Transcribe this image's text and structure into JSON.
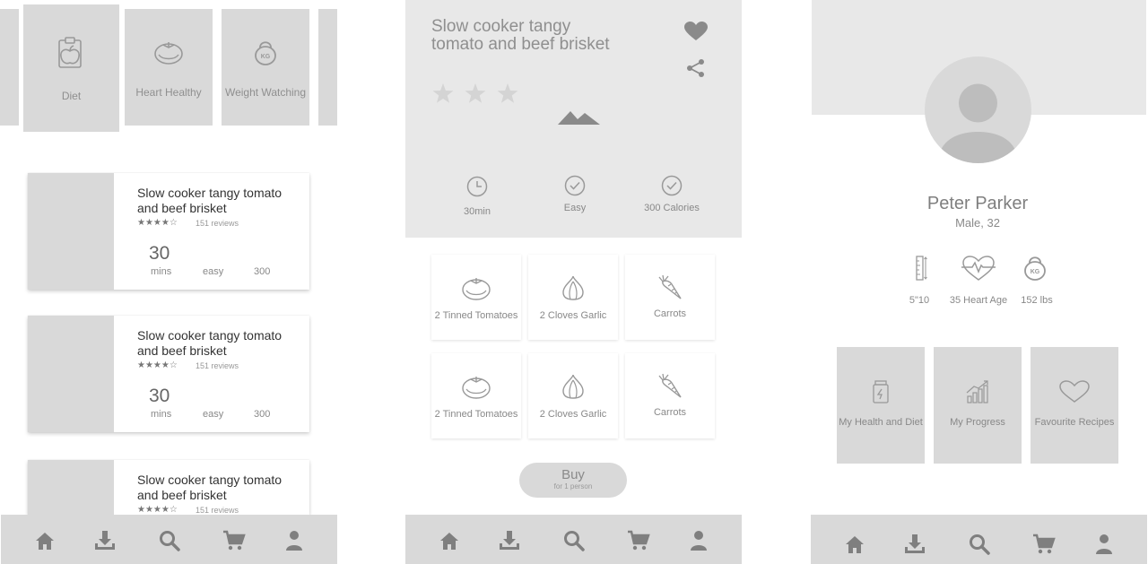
{
  "categories": [
    {
      "label": "Diet",
      "icon": "clipboard-apple-icon"
    },
    {
      "label": "Heart Healthy",
      "icon": "tomato-icon"
    },
    {
      "label": "Weight Watching",
      "icon": "kettlebell-icon"
    }
  ],
  "kettlebell_text": "KG",
  "recipes": [
    {
      "title": "Slow cooker tangy tomato and beef brisket",
      "stars": "★★★★☆",
      "reviews": "151 reviews",
      "time": "30",
      "time_unit": "mins",
      "difficulty": "easy",
      "calories": "300"
    },
    {
      "title": "Slow cooker tangy tomato and beef brisket",
      "stars": "★★★★☆",
      "reviews": "151 reviews",
      "time": "30",
      "time_unit": "mins",
      "difficulty": "easy",
      "calories": "300"
    },
    {
      "title": "Slow cooker tangy tomato and beef brisket",
      "stars": "★★★★☆",
      "reviews": "151 reviews"
    }
  ],
  "nav": [
    "home-icon",
    "download-icon",
    "search-icon",
    "cart-icon",
    "user-icon"
  ],
  "detail": {
    "title": "Slow cooker tangy tomato and beef brisket",
    "rating": 3,
    "info": [
      {
        "label": "30min",
        "icon": "clock-icon"
      },
      {
        "label": "Easy",
        "icon": "check-circle-icon"
      },
      {
        "label": "300 Calories",
        "icon": "check-circle-icon"
      }
    ],
    "ingredients": [
      {
        "label": "2 Tinned Tomatoes",
        "icon": "tomato-icon"
      },
      {
        "label": "2 Cloves Garlic",
        "icon": "garlic-icon"
      },
      {
        "label": "Carrots",
        "icon": "carrot-icon"
      },
      {
        "label": "2 Tinned Tomatoes",
        "icon": "tomato-icon"
      },
      {
        "label": "2 Cloves Garlic",
        "icon": "garlic-icon"
      },
      {
        "label": "Carrots",
        "icon": "carrot-icon"
      }
    ],
    "buy_label": "Buy",
    "buy_sub": "for 1 person"
  },
  "profile": {
    "name": "Peter Parker",
    "subtitle": "Male, 32",
    "stats": [
      {
        "label": "5\"10",
        "icon": "height-ruler-icon"
      },
      {
        "label": "35 Heart Age",
        "icon": "heartbeat-icon"
      },
      {
        "label": "152 lbs",
        "icon": "kettlebell-icon"
      }
    ],
    "tiles": [
      {
        "label": "My Health and Diet",
        "icon": "supplement-jar-icon"
      },
      {
        "label": "My Progress",
        "icon": "progress-chart-icon"
      },
      {
        "label": "Favourite Recipes",
        "icon": "heart-outline-icon"
      }
    ]
  }
}
